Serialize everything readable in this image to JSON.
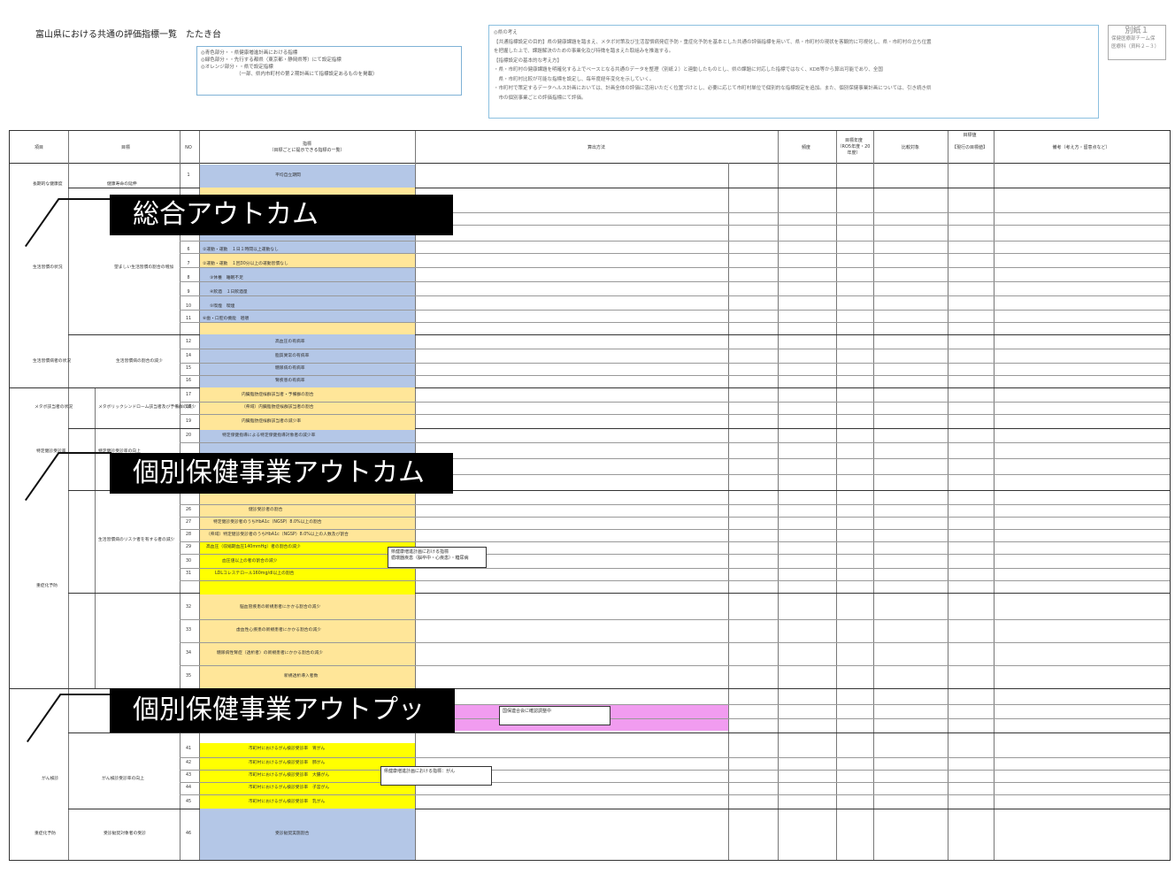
{
  "doc": {
    "title": "富山県における共通の評価指標一覧　たたき台",
    "legend": [
      "◎青色部分・・県健康増進計画における指標",
      "◎緑色部分・・先行する都県（東京都・静岡県等）にて設定指標",
      "◎オレンジ部分・・県で設定指標",
      "（一部、県内市町村の第２期計画にて指標設定あるものを掲載）"
    ],
    "policy_lines": [
      "◎県の考え",
      "【共通指標設定の目的】県の健康課題を踏まえ、メタボ対策及び生活習慣病発症予防・重症化予防を基本とした共通の評価指標を用いて、県・市町村の現状を客観的に可視化し、県・市町村の立ち位置",
      "を把握した上で、課題解決のための事業化及び特徴を踏まえた取組みを推進する。",
      "【指標設定の基本的な考え方】",
      "・県・市町村の健康課題を明確化する上でベースとなる共通のデータを整理（別紙２）と連動したものとし、県の課題に対応した指標ではなく、KDB等から算出可能であり、全国",
      "　県・市町村比較が可能な指標を設定し、毎年度経年変化を示していく。",
      "・市町村で策定するデータヘルス計画においては、計画全体の評価に活用いただく位置づけとし、必要に応じて市町村単位で個別的な指標設定を追加。また、個別保健事業計画については、引き続き県",
      "　市の個別事業ごとの評価指標にて評価。"
    ],
    "appendix": {
      "title": "別紙１",
      "line1": "保健医療部チーム保",
      "line2": "医療科（資料２−３）"
    }
  },
  "table": {
    "headers": [
      "項目",
      "目標",
      "NO",
      "指標\n（目標ごとに提示できる指標の一覧）",
      "算出方法",
      "頻度",
      "目標年度\n（RO5年度・20 年度）",
      "比較対象",
      "目標値\n\n【現行の目標値】",
      "備考（考え方・留意点など）"
    ],
    "categories": [
      "総合アウトカム",
      "個別保健事業アウトカム",
      "個別保健事業アウトプット"
    ],
    "groups": [
      {
        "label": "長期的な健康度",
        "goal": "健康寿命の延伸"
      },
      {
        "label": "生活習慣の状況",
        "goal": "望ましい生活習慣の割合の増加"
      },
      {
        "label": "生活習慣病者の状況",
        "goal": "生活習慣病の割合の減少"
      },
      {
        "label": "メタボ該当者の状況",
        "goal": "メタボリックシンドローム該当者及び予備群の減少"
      },
      {
        "label": "特定健診受診率",
        "goal": "特定健診受診率の向上"
      },
      {
        "label": "重症化予防",
        "goal": "生活習慣病のリスク者を有する者の減少"
      },
      {
        "label": "がん検診",
        "goal": "がん検診受診率の向上"
      },
      {
        "label": "重症化予防",
        "goal": "受診勧奨対象者の受診"
      }
    ],
    "rows": [
      {
        "no": "1",
        "text": "平均自立期間"
      },
      {
        "no": "6",
        "text": "②運動・運動　１日１時間以上運動なし"
      },
      {
        "no": "7",
        "text": "②運動・運動　１回30分以上の運動習慣なし"
      },
      {
        "no": "8",
        "text": "③休養　睡眠不足"
      },
      {
        "no": "9",
        "text": "④飲酒　１日飲酒量"
      },
      {
        "no": "10",
        "text": "⑤喫煙　喫煙"
      },
      {
        "no": "11",
        "text": "⑥歯・口腔の機能　咀嚼"
      },
      {
        "no": "12",
        "text": "高血圧の有病率"
      },
      {
        "no": "14",
        "text": "脂質異常の有病率"
      },
      {
        "no": "15",
        "text": "糖尿病の有病率"
      },
      {
        "no": "16",
        "text": "腎疾患の有病率"
      },
      {
        "no": "17",
        "text": "内臓脂肪症候群該当者・予備群の割合"
      },
      {
        "no": "18",
        "text": "（県域）内臓脂肪症候群該当者の割合"
      },
      {
        "no": "19",
        "text": "内臓脂肪症候群該当者の減少率"
      },
      {
        "no": "20",
        "text": "特定保健指導による特定保健指導対象者の減少率"
      },
      {
        "no": "26",
        "text": "健診受診者の割合"
      },
      {
        "no": "27",
        "text": "特定健診受診者のうちHbA1c（NGSP）8.0%以上の割合"
      },
      {
        "no": "28",
        "text": "（県域）特定健診受診者のうちHbA1c（NGSP）8.0%以上の人数及び割合"
      },
      {
        "no": "29",
        "text": "高血圧（収縮期血圧140mmHg）者の割合の減少"
      },
      {
        "no": "30",
        "text": "血圧値以上の者の割合の減少"
      },
      {
        "no": "31",
        "text": "LDLコレステロール160mg/dl以上の割合"
      },
      {
        "no": "32",
        "text": "脳血管疾患の新規患者にかかる割合の減少"
      },
      {
        "no": "33",
        "text": "虚血性心疾患の新規患者にかかる割合の減少"
      },
      {
        "no": "34",
        "text": "糖尿病性腎症（透析者）の新規患者にかかる割合の減少"
      },
      {
        "no": "35",
        "text": "新規透析導入者数"
      },
      {
        "no": "41",
        "text": "市町村におけるがん検診受診率　胃がん"
      },
      {
        "no": "42",
        "text": "市町村におけるがん検診受診率　肺がん"
      },
      {
        "no": "43",
        "text": "市町村におけるがん検診受診率　大腸がん"
      },
      {
        "no": "44",
        "text": "市町村におけるがん検診受診率　子宮がん"
      },
      {
        "no": "45",
        "text": "市町村におけるがん検診受診率　乳がん"
      },
      {
        "no": "46",
        "text": "受診勧奨実施割合"
      }
    ],
    "callouts": [
      "県健康増進計画における指標\n循環器疾患（脳卒中・心疾患）・糖尿病",
      "国保連合会に確認調整中",
      "県健康増進計画における指標：がん"
    ]
  }
}
